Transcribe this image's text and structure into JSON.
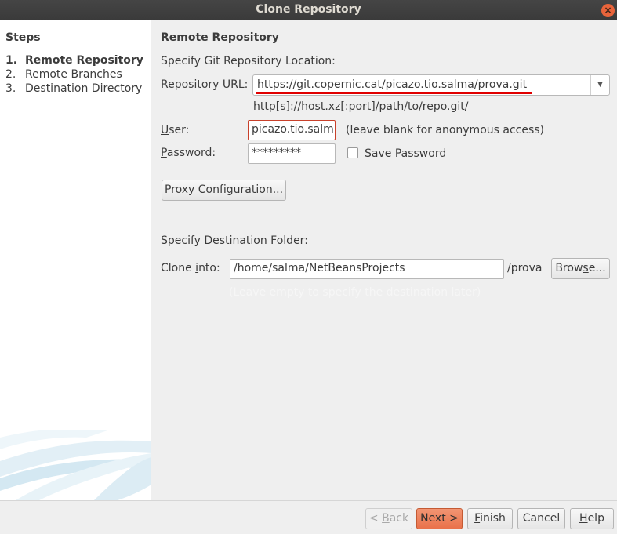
{
  "window": {
    "title": "Clone Repository",
    "close_glyph": "×"
  },
  "steps": {
    "title": "Steps",
    "items": [
      {
        "num": "1.",
        "label": "Remote Repository",
        "active": true
      },
      {
        "num": "2.",
        "label": "Remote Branches",
        "active": false
      },
      {
        "num": "3.",
        "label": "Destination Directory",
        "active": false
      }
    ]
  },
  "main": {
    "title": "Remote Repository",
    "location_label": "Specify Git Repository Location:",
    "repo_url_label_pre": "",
    "repo_url_label_mn": "R",
    "repo_url_label_post": "epository URL:",
    "repo_url_value": "https://git.copernic.cat/picazo.tio.salma/prova.git",
    "repo_url_hint": "http[s]://host.xz[:port]/path/to/repo.git/",
    "user_label_mn": "U",
    "user_label_post": "ser:",
    "user_value": "picazo.tio.salm",
    "user_hint": "(leave blank for anonymous access)",
    "password_label_mn": "P",
    "password_label_post": "assword:",
    "password_value": "*********",
    "save_password_mn": "S",
    "save_password_post": "ave Password",
    "proxy_pre": "Pro",
    "proxy_mn": "x",
    "proxy_post": "y Configuration...",
    "destination_label": "Specify Destination Folder:",
    "clone_into_pre": "Clone ",
    "clone_into_mn": "i",
    "clone_into_post": "nto:",
    "clone_into_value": "/home/salma/NetBeansProjects",
    "clone_suffix": "/prova",
    "browse_pre": "Brow",
    "browse_mn": "s",
    "browse_post": "e...",
    "destination_hint": "(Leave empty to specify the destination later)"
  },
  "buttons": {
    "back_pre": "< ",
    "back_mn": "B",
    "back_post": "ack",
    "next": "Next >",
    "finish_mn": "F",
    "finish_post": "inish",
    "cancel": "Cancel",
    "help_mn": "H",
    "help_post": "elp"
  },
  "colors": {
    "accent": "#e9714a",
    "highlight_underline": "#e00000",
    "titlebar": "#3e3e3e"
  },
  "icons": {
    "combo_arrow": "chevron-down-icon",
    "close": "close-icon"
  }
}
